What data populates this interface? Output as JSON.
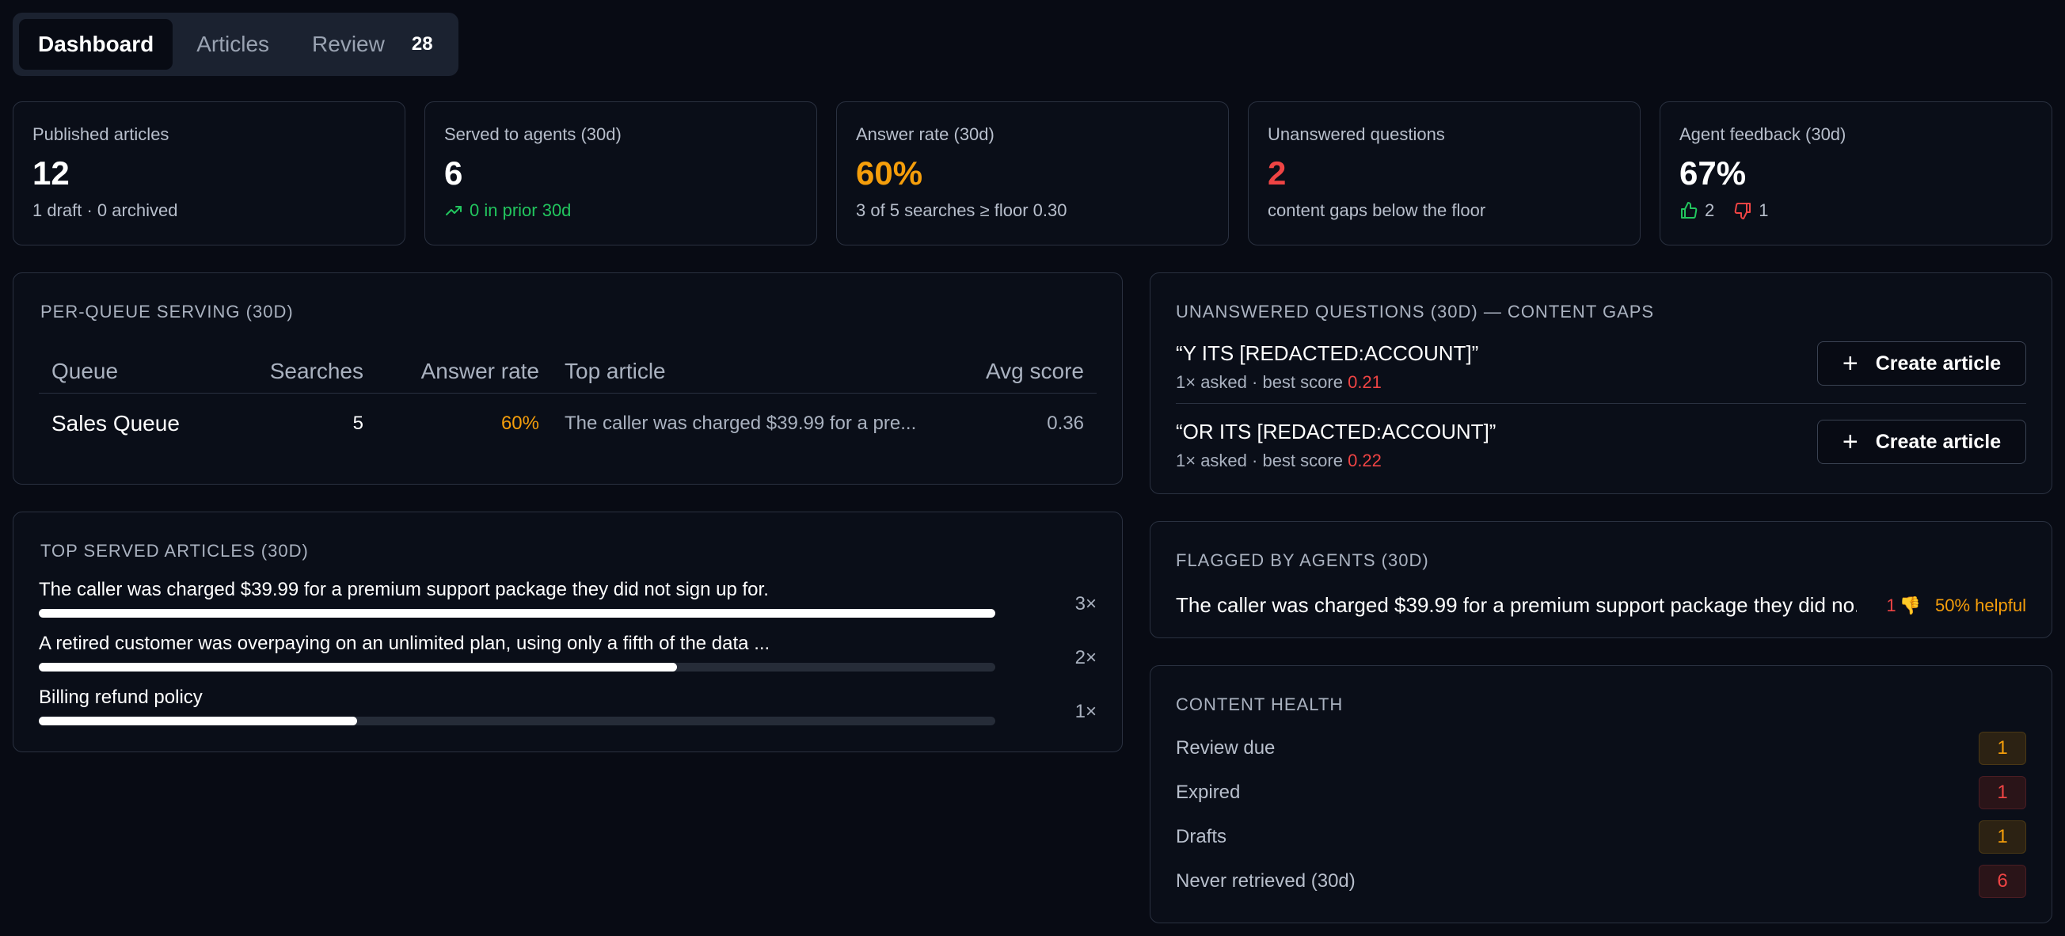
{
  "tabs": [
    {
      "label": "Dashboard",
      "active": true
    },
    {
      "label": "Articles"
    },
    {
      "label": "Review",
      "badge": "28"
    }
  ],
  "kpis": [
    {
      "label": "Published articles",
      "value": "12",
      "sub": "1 draft · 0 archived"
    },
    {
      "label": "Served to agents (30d)",
      "value": "6",
      "sub": "0 in prior 30d",
      "sub_icon": "trend-up-icon"
    },
    {
      "label": "Answer rate (30d)",
      "value": "60%",
      "value_color": "#f59e0b",
      "sub": "3 of 5 searches ≥ floor 0.30"
    },
    {
      "label": "Unanswered questions",
      "value": "2",
      "value_color": "#ef4444",
      "sub": "content gaps below the floor"
    },
    {
      "label": "Agent feedback (30d)",
      "value": "67%",
      "thumbs_up": "2",
      "thumbs_down": "1"
    }
  ],
  "per_queue": {
    "title": "Per-queue serving (30d)",
    "headers": [
      "Queue",
      "Searches",
      "Answer rate",
      "Top article",
      "Avg score"
    ],
    "rows": [
      {
        "queue": "Sales Queue",
        "searches": "5",
        "answer_rate": "60%",
        "top_article": "The caller was charged $39.99 for a pre...",
        "avg_score": "0.36"
      }
    ]
  },
  "top_served": {
    "title": "Top served articles (30d)",
    "items": [
      {
        "title": "The caller was charged $39.99 for a premium support package they did not sign up for.",
        "count": "3×",
        "fraction": 1.0
      },
      {
        "title": "A retired customer was overpaying on an unlimited plan, using only a fifth of the data ...",
        "count": "2×",
        "fraction": 0.667
      },
      {
        "title": "Billing refund policy",
        "count": "1×",
        "fraction": 0.333
      }
    ]
  },
  "unanswered": {
    "title": "Unanswered questions (30d) — content gaps",
    "items": [
      {
        "question": "“Y ITS [REDACTED:ACCOUNT]”",
        "meta": "1× asked · best score",
        "score": "0.21",
        "button": "Create article"
      },
      {
        "question": "“OR ITS [REDACTED:ACCOUNT]”",
        "meta": "1× asked · best score",
        "score": "0.22",
        "button": "Create article"
      }
    ]
  },
  "flagged": {
    "title": "Flagged by agents (30d)",
    "items": [
      {
        "title": "The caller was charged $39.99 for a premium support package they did no...",
        "count": "1",
        "helpful": "50% helpful"
      }
    ]
  },
  "health": {
    "title": "Content health",
    "items": [
      {
        "label": "Review due",
        "count": "1",
        "tone": "o"
      },
      {
        "label": "Expired",
        "count": "1",
        "tone": "r"
      },
      {
        "label": "Drafts",
        "count": "1",
        "tone": "o"
      },
      {
        "label": "Never retrieved (30d)",
        "count": "6",
        "tone": "r"
      }
    ]
  },
  "colors": {
    "accent_orange": "#f59e0b",
    "danger_red": "#ef4444",
    "success_green": "#22c55e",
    "background": "#080b14"
  }
}
